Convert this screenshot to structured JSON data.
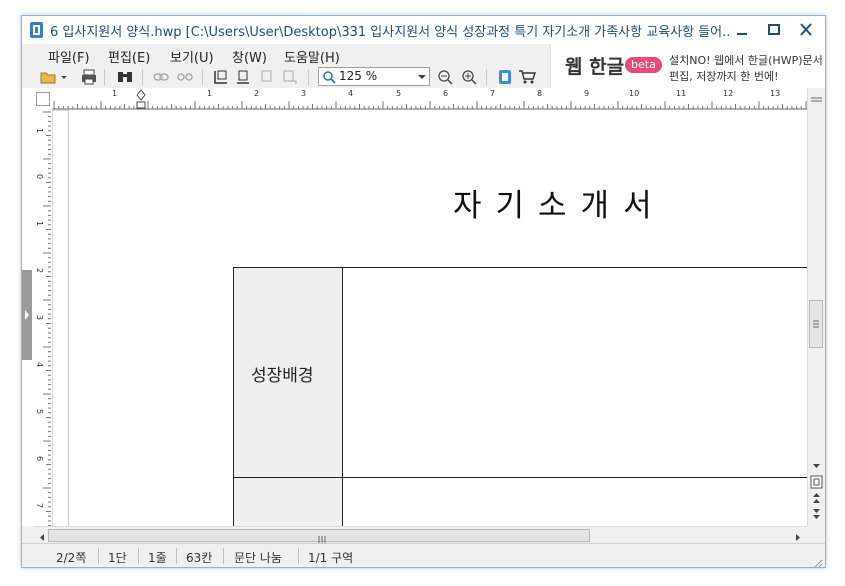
{
  "window": {
    "title": "6 입사지원서 양식.hwp [C:\\Users\\User\\Desktop\\331 입사지원서 양식 성장과정 특기 자기소개 가족사항 교육사항 들어..."
  },
  "menu": {
    "items": [
      "파일(F)",
      "편집(E)",
      "보기(U)",
      "창(W)",
      "도움말(H)"
    ]
  },
  "ad": {
    "title": "웹 한글",
    "badge": "beta",
    "line1": "설치NO! 웹에서 한글(HWP)문서 열",
    "line2": "편집, 저장까지 한 번에!"
  },
  "toolbar": {
    "zoom": "125 %"
  },
  "ruler": {
    "h_numbers": [
      "1",
      "1",
      "2",
      "3",
      "4",
      "5",
      "6",
      "7",
      "8",
      "9",
      "10",
      "11",
      "12",
      "13"
    ],
    "v_numbers": [
      "1",
      "0",
      "1",
      "2",
      "3",
      "4",
      "5",
      "6",
      "7"
    ]
  },
  "document": {
    "title": "자기소개서",
    "row1_label": "성장배경"
  },
  "status": {
    "page": "2/2쪽",
    "column": "1단",
    "line": "1줄",
    "char": "63칸",
    "mode": "문단 나눔",
    "section": "1/1 구역"
  },
  "colors": {
    "title_text": "#1f4e79",
    "window_border": "#8fb3d9",
    "ad_badge": "#e84a7a",
    "label_cell_bg": "#efefef"
  }
}
